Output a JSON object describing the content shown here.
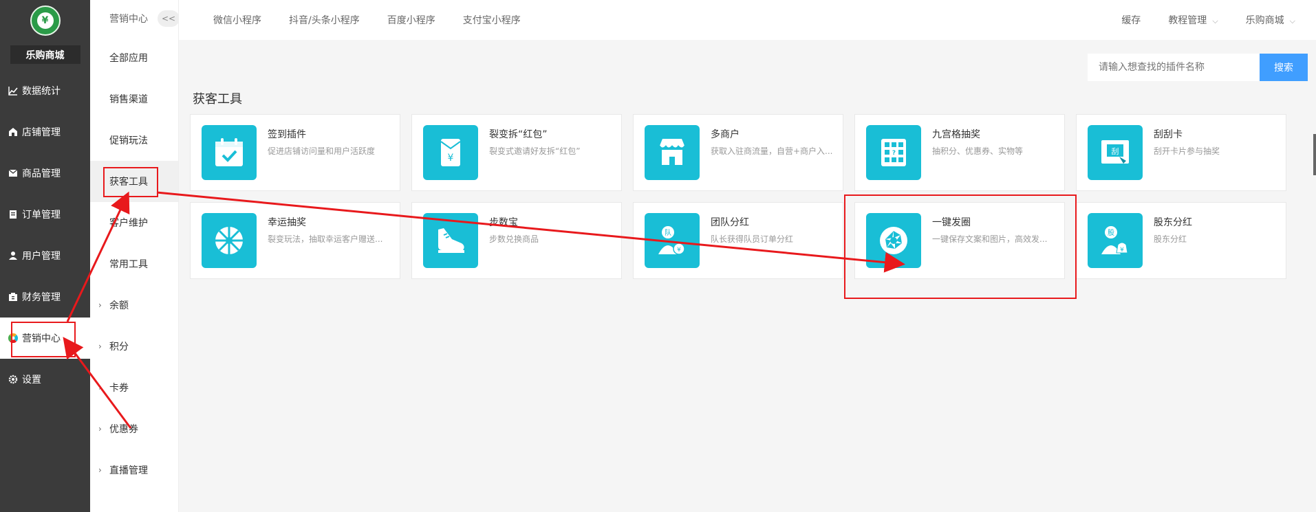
{
  "brand": {
    "shop_name": "乐购商城"
  },
  "sidebar": {
    "items": [
      {
        "label": "数据统计",
        "icon": "chart-icon"
      },
      {
        "label": "店铺管理",
        "icon": "store-icon"
      },
      {
        "label": "商品管理",
        "icon": "box-icon"
      },
      {
        "label": "订单管理",
        "icon": "order-icon"
      },
      {
        "label": "用户管理",
        "icon": "user-icon"
      },
      {
        "label": "财务管理",
        "icon": "finance-icon"
      },
      {
        "label": "营销中心",
        "icon": "marketing-icon"
      },
      {
        "label": "设置",
        "icon": "gear-icon"
      }
    ]
  },
  "subnav": {
    "header": "营销中心",
    "collapse": "<<",
    "items": [
      {
        "label": "全部应用"
      },
      {
        "label": "销售渠道"
      },
      {
        "label": "促销玩法"
      },
      {
        "label": "获客工具"
      },
      {
        "label": "客户维护"
      },
      {
        "label": "常用工具"
      },
      {
        "label": "余额"
      },
      {
        "label": "积分"
      },
      {
        "label": "卡券"
      },
      {
        "label": "优惠券"
      },
      {
        "label": "直播管理"
      }
    ]
  },
  "topbar": {
    "tabs": [
      "微信小程序",
      "抖音/头条小程序",
      "百度小程序",
      "支付宝小程序"
    ],
    "right": [
      "缓存",
      "教程管理",
      "乐购商城"
    ]
  },
  "search": {
    "placeholder": "请输入想查找的插件名称",
    "button": "搜索"
  },
  "section": {
    "title": "获客工具"
  },
  "cards": [
    {
      "name": "签到插件",
      "desc": "促进店铺访问量和用户活跃度",
      "icon": "calendar-check-icon"
    },
    {
      "name": "裂变拆“红包”",
      "desc": "裂变式邀请好友拆“红包”",
      "icon": "red-envelope-icon"
    },
    {
      "name": "多商户",
      "desc": "获取入驻商流量，自营+商户入...",
      "icon": "shop-icon"
    },
    {
      "name": "九宫格抽奖",
      "desc": "抽积分、优惠券、实物等",
      "icon": "grid-lottery-icon"
    },
    {
      "name": "刮刮卡",
      "desc": "刮开卡片参与抽奖",
      "icon": "scratch-card-icon"
    },
    {
      "name": "幸运抽奖",
      "desc": "裂变玩法，抽取幸运客户赠送...",
      "icon": "wheel-icon"
    },
    {
      "name": "步数宝",
      "desc": "步数兑换商品",
      "icon": "shoe-icon"
    },
    {
      "name": "团队分红",
      "desc": "队长获得队员订单分红",
      "icon": "team-bonus-icon"
    },
    {
      "name": "一键发圈",
      "desc": "一键保存文案和图片，高效发...",
      "icon": "aperture-icon"
    },
    {
      "name": "股东分红",
      "desc": "股东分红",
      "icon": "shareholder-icon"
    }
  ],
  "colors": {
    "accent": "#19bed6",
    "sidebar": "#3b3b3b",
    "primary": "#409eff",
    "annotation": "#e8191c"
  },
  "icon_glyphs": {
    "logo": "¥",
    "red_envelope": "¥",
    "grid": "?",
    "scratch": "刮",
    "team": "队",
    "shareholder": "股",
    "sub_chevron": "›",
    "top_drop": "⌵"
  }
}
